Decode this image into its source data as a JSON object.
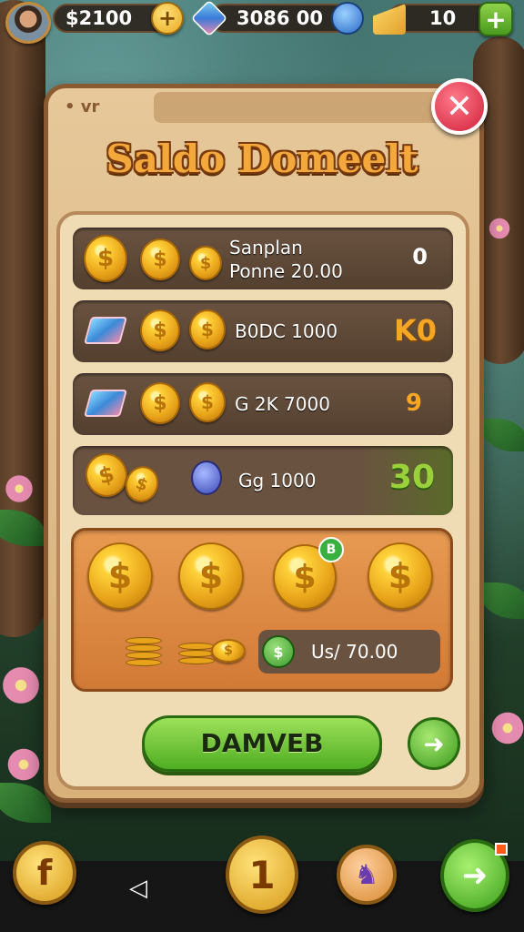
{
  "topbar": {
    "coins": "$2100",
    "gems": "3086 00",
    "energy": "10",
    "plus": "+"
  },
  "panel": {
    "title": "Saldo Domeelt",
    "dots": "• vr",
    "close": "✕"
  },
  "rows": [
    {
      "line1": "Sanplan",
      "line2": "Ponne 20.00",
      "value": "0",
      "value_color": "#ffffff"
    },
    {
      "text": "B0DC 1000",
      "value": "K0",
      "value_color": "#f5a623"
    },
    {
      "text": "G 2K 7000",
      "value": "9",
      "value_color": "#f5a623"
    },
    {
      "text": "Gg 1000",
      "value": "30",
      "value_color": "#9ad13a"
    }
  ],
  "featured": {
    "price": "Us/ 70.00",
    "price_icon": "$",
    "tag": "B",
    "coin_symbol": "$"
  },
  "action": {
    "main_label": "DAMVEB",
    "side_icon": "➜"
  },
  "bottom_nav": {
    "f_label": "f",
    "back_label": "◁",
    "one_label": "1",
    "cup_icon": "♞",
    "map_icon": "➜"
  }
}
